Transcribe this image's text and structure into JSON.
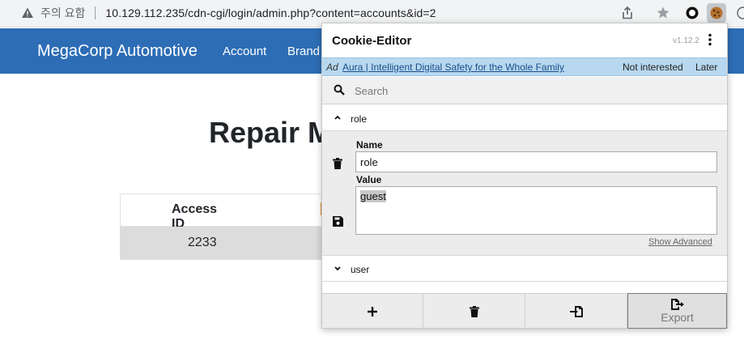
{
  "browser": {
    "security_text": "주의 요함",
    "url": "10.129.112.235/cdn-cgi/login/admin.php?content=accounts&id=2"
  },
  "site": {
    "brand": "MegaCorp Automotive",
    "nav": [
      "Account",
      "Brand"
    ],
    "heading": "Repair M",
    "table": {
      "headers": [
        "Access ID"
      ],
      "rows": [
        [
          "2233"
        ]
      ]
    }
  },
  "cookie_editor": {
    "title": "Cookie-Editor",
    "version": "v1.12.2",
    "ad": {
      "label": "Ad",
      "link_text": "Aura | Intelligent Digital Safety for the Whole Family",
      "not_interested": "Not interested",
      "later": "Later"
    },
    "search_placeholder": "Search",
    "cookies": [
      {
        "name": "role",
        "expanded": true
      },
      {
        "name": "user",
        "expanded": false
      }
    ],
    "editor": {
      "name_label": "Name",
      "name_value": "role",
      "value_label": "Value",
      "value_value": "guest",
      "show_advanced": "Show Advanced"
    },
    "footer": {
      "export_label": "Export"
    }
  }
}
